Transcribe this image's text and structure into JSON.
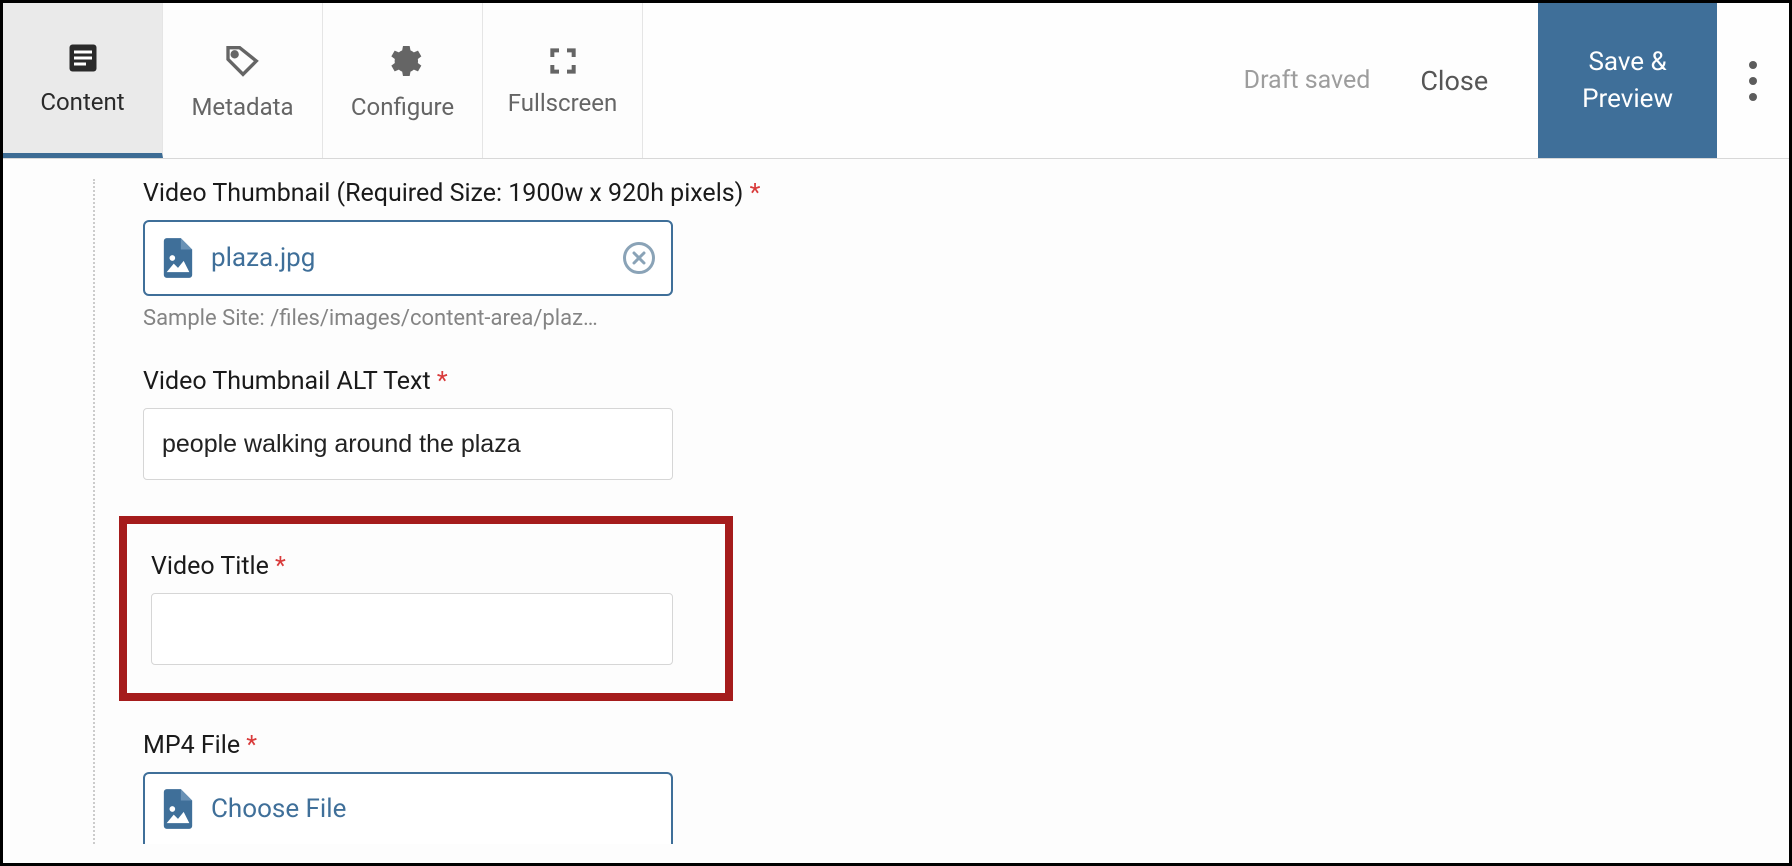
{
  "toolbar": {
    "tabs": {
      "content": "Content",
      "metadata": "Metadata",
      "configure": "Configure",
      "fullscreen": "Fullscreen"
    },
    "status": "Draft saved",
    "close": "Close",
    "primary_line1": "Save &",
    "primary_line2": "Preview"
  },
  "fields": {
    "thumbnail": {
      "label": "Video Thumbnail (Required Size: 1900w x 920h pixels)",
      "filename": "plaza.jpg",
      "help": "Sample Site: /files/images/content-area/plaz…"
    },
    "alt_text": {
      "label": "Video Thumbnail ALT Text",
      "value": "people walking around the plaza"
    },
    "video_title": {
      "label": "Video Title",
      "value": ""
    },
    "mp4": {
      "label": "MP4 File",
      "choose": "Choose File"
    }
  }
}
